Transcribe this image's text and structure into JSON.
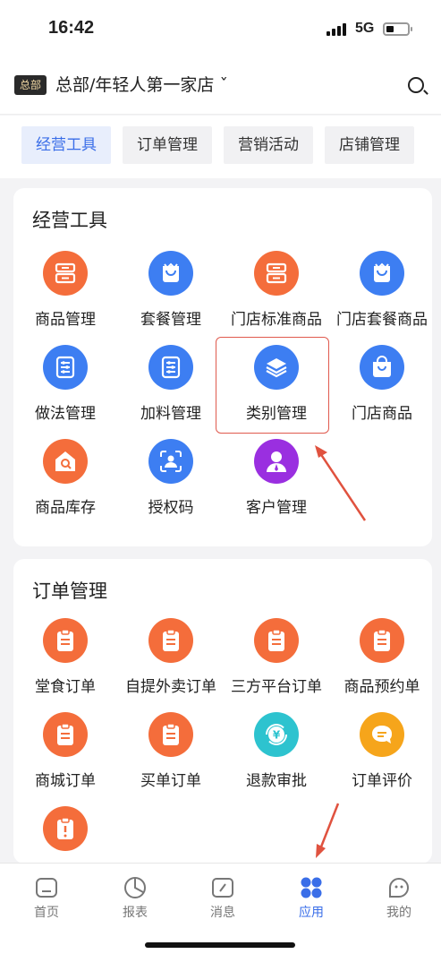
{
  "status_bar": {
    "time": "16:42",
    "network": "5G"
  },
  "header": {
    "badge": "总部",
    "store": "总部/年轻人第一家店 ˇ"
  },
  "tabs": [
    {
      "label": "经营工具",
      "active": true
    },
    {
      "label": "订单管理",
      "active": false
    },
    {
      "label": "营销活动",
      "active": false
    },
    {
      "label": "店铺管理",
      "active": false
    }
  ],
  "tools": {
    "title": "经营工具",
    "items": [
      {
        "label": "商品管理",
        "icon": "store-icon",
        "color": "#f46d3b"
      },
      {
        "label": "套餐管理",
        "icon": "bag-icon",
        "color": "#3d7ef2"
      },
      {
        "label": "门店标准商品",
        "icon": "store-icon",
        "color": "#f46d3b"
      },
      {
        "label": "门店套餐商品",
        "icon": "bag-icon",
        "color": "#3d7ef2"
      },
      {
        "label": "做法管理",
        "icon": "list-icon",
        "color": "#3d7ef2"
      },
      {
        "label": "加料管理",
        "icon": "list-icon",
        "color": "#3d7ef2"
      },
      {
        "label": "类别管理",
        "icon": "layers-icon",
        "color": "#3d7ef2"
      },
      {
        "label": "门店商品",
        "icon": "shopping-bag-icon",
        "color": "#3d7ef2"
      },
      {
        "label": "商品库存",
        "icon": "warehouse-icon",
        "color": "#f46d3b"
      },
      {
        "label": "授权码",
        "icon": "scan-face-icon",
        "color": "#3d7ef2"
      },
      {
        "label": "客户管理",
        "icon": "user-icon",
        "color": "#9a2fe0"
      }
    ]
  },
  "orders": {
    "title": "订单管理",
    "items": [
      {
        "label": "堂食订单",
        "icon": "clipboard-icon",
        "color": "#f46d3b"
      },
      {
        "label": "自提外卖订单",
        "icon": "clipboard-icon",
        "color": "#f46d3b"
      },
      {
        "label": "三方平台订单",
        "icon": "clipboard-icon",
        "color": "#f46d3b"
      },
      {
        "label": "商品预约单",
        "icon": "clipboard-icon",
        "color": "#f46d3b"
      },
      {
        "label": "商城订单",
        "icon": "clipboard-icon",
        "color": "#f46d3b"
      },
      {
        "label": "买单订单",
        "icon": "clipboard-icon",
        "color": "#f46d3b"
      },
      {
        "label": "退款审批",
        "icon": "refund-icon",
        "color": "#2dc3cf"
      },
      {
        "label": "订单评价",
        "icon": "comment-icon",
        "color": "#f6a51b"
      },
      {
        "label": "",
        "icon": "alert-clipboard-icon",
        "color": "#f46d3b"
      }
    ]
  },
  "bottom_nav": [
    {
      "label": "首页",
      "icon": "home-icon",
      "active": false
    },
    {
      "label": "报表",
      "icon": "chart-icon",
      "active": false
    },
    {
      "label": "消息",
      "icon": "message-icon",
      "active": false
    },
    {
      "label": "应用",
      "icon": "apps-icon",
      "active": true
    },
    {
      "label": "我的",
      "icon": "profile-icon",
      "active": false
    }
  ]
}
